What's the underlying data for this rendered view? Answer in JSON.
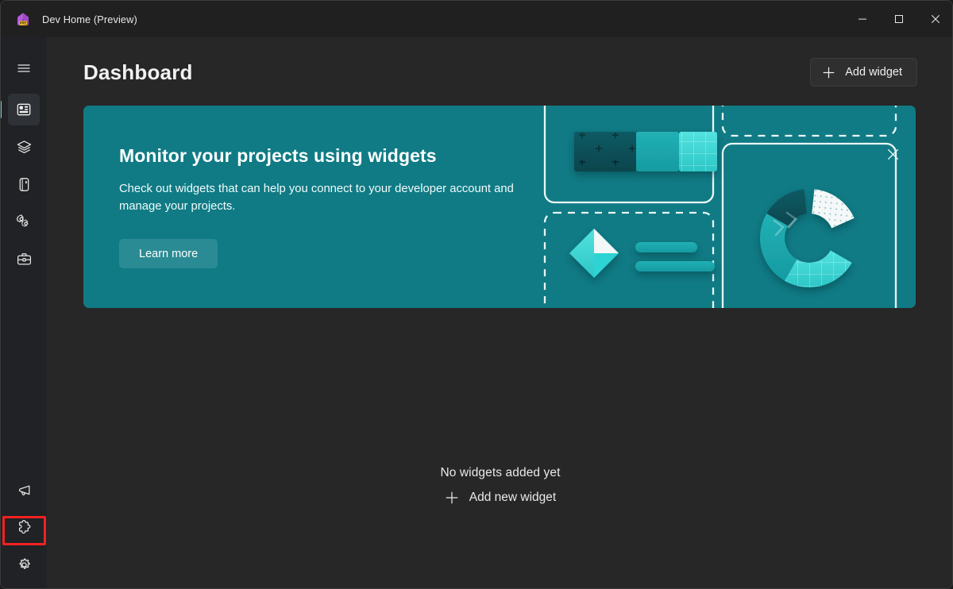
{
  "window": {
    "title": "Dev Home (Preview)",
    "app_icon": "dev-home-house-icon",
    "badge_text": "PRE",
    "controls": [
      {
        "name": "minimize",
        "glyph": "minimize-icon"
      },
      {
        "name": "maximize",
        "glyph": "maximize-icon"
      },
      {
        "name": "close",
        "glyph": "close-icon"
      }
    ]
  },
  "sidebar": {
    "menu_button": {
      "label": "Navigation menu",
      "icon": "hamburger-menu-icon"
    },
    "items": [
      {
        "label": "Dashboard",
        "icon": "dashboard-icon",
        "selected": true
      },
      {
        "label": "Machine configuration",
        "icon": "layers-icon",
        "selected": false
      },
      {
        "label": "Environments",
        "icon": "device-icon",
        "selected": false
      },
      {
        "label": "Utilities",
        "icon": "gears-icon",
        "selected": false
      },
      {
        "label": "Workspaces",
        "icon": "toolbox-icon",
        "selected": false
      }
    ],
    "bottom_items": [
      {
        "label": "Send feedback",
        "icon": "megaphone-icon",
        "highlighted": false
      },
      {
        "label": "Extensions",
        "icon": "puzzle-piece-icon",
        "highlighted": true
      },
      {
        "label": "Settings",
        "icon": "gear-icon",
        "highlighted": false
      }
    ]
  },
  "header": {
    "title": "Dashboard",
    "add_widget_label": "Add widget",
    "add_widget_icon": "plus-icon"
  },
  "banner": {
    "title": "Monitor your projects using widgets",
    "subtitle": "Check out widgets that can help you connect to your developer account and manage your projects.",
    "cta_label": "Learn more",
    "close_icon": "close-icon"
  },
  "empty_state": {
    "title": "No widgets added yet",
    "action_label": "Add new widget",
    "action_icon": "plus-icon"
  },
  "colors": {
    "accent_teal": "#107b85",
    "cta_teal": "#2a8b94",
    "selection_indicator": "#6fd3d8",
    "highlight_red": "#f22121",
    "window_background": "#272727",
    "rail_background": "#202225",
    "titlebar_background": "#202020"
  }
}
